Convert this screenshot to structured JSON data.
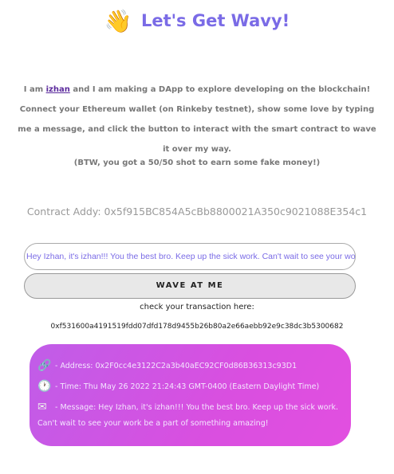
{
  "header": {
    "emoji": "👋",
    "title": "Let's Get Wavy!"
  },
  "bio": {
    "prefix": "I am ",
    "name": "izhan",
    "rest": " and I am making a DApp to explore developing on the blockchain! Connect your Ethereum wallet (on Rinkeby testnet), show some love by typing me a message, and click the button to interact with the smart contract to wave it over my way.",
    "btw": "(BTW, you got a 50/50 shot to earn some fake money!)"
  },
  "contract": {
    "label": "Contract Addy: 0x5f915BC854A5cBb8800021A350c9021088E354c1"
  },
  "message_input": {
    "value": "Hey Izhan, it's izhan!!! You the best bro. Keep up the sick work. Can't wait to see your work be a part of something amazing!"
  },
  "wave_button": {
    "label": "WAVE AT ME"
  },
  "transaction": {
    "label": "check your transaction here:",
    "hash": "0xf531600a4191519fdd07dfd178d9455b26b80a2e66aebb92e9c38dc3b5300682"
  },
  "wave_card": {
    "address_icon": "link-icon",
    "address": " - Address: 0x2F0cc4e3122C2a3b40aEC92CF0d86B36313c93D1",
    "time_icon": "clock-icon",
    "time": " - Time: Thu May 26 2022 21:24:43 GMT-0400 (Eastern Daylight Time)",
    "message_icon": "envelope-icon",
    "message": " - Message: Hey Izhan, it's izhan!!! You the best bro. Keep up the sick work.",
    "message_tail": "Can't wait to see your work be a part of something amazing!"
  }
}
